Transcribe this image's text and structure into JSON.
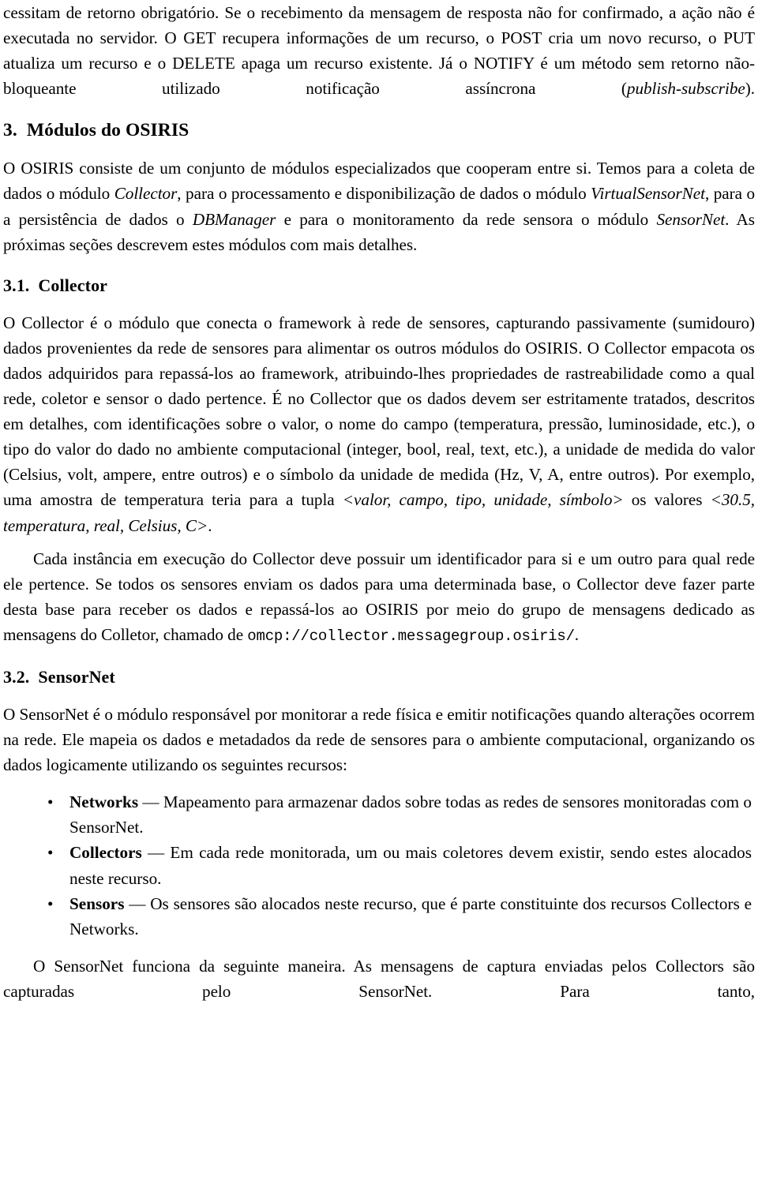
{
  "document": {
    "language": "pt-BR",
    "paragraphs": {
      "p_intro_continuation": {
        "lead": "cessitam de retorno obrigatório. Se o recebimento da mensagem de resposta não for confirmado, a ação não é executada no servidor. O GET recupera informações de um recurso, o POST cria um novo recurso, o PUT atualiza um recurso e o DELETE apaga um recurso existente. Já o NOTIFY é um método sem retorno não-bloqueante utilizado notificação assíncrona (",
        "italic": "publish-subscribe",
        "tail": ")."
      },
      "p_modules_overview": {
        "s1": "O OSIRIS consiste de um conjunto de módulos especializados que cooperam entre si. Temos para a coleta de dados o módulo ",
        "i1": "Collector",
        "s2": ", para o processamento e disponibilização de dados o módulo ",
        "i2": "VirtualSensorNet",
        "s3": ", para o a persistência de dados o ",
        "i3": "DBManager",
        "s4": " e para o monitoramento da rede sensora o módulo ",
        "i4": "SensorNet",
        "s5": ". As próximas seções descrevem estes módulos com mais detalhes."
      },
      "p_collector_1": {
        "s1": "O Collector é o módulo que conecta o framework à rede de sensores, capturando passivamente (sumidouro) dados provenientes da rede de sensores para alimentar os outros módulos do OSIRIS. O Collector empacota os dados adquiridos para repassá-los ao framework, atribuindo-lhes propriedades de rastreabilidade como a qual rede, coletor e sensor o dado pertence. É no Collector que os dados devem ser estritamente tratados, descritos em detalhes, com identificações sobre o valor, o nome do campo (temperatura, pressão, luminosidade, etc.), o tipo do valor do dado no ambiente computacional (integer, bool, real, text, etc.), a unidade de medida do valor (Celsius, volt, ampere, entre outros) e o símbolo da unidade de medida (Hz, V, A, entre outros). Por exemplo, uma amostra de temperatura teria para a tupla ",
        "i1": "<valor, campo, tipo, unidade, símbolo>",
        "s2": " os valores ",
        "i2": "<30.5, temperatura, real, Celsius, C>",
        "s3": "."
      },
      "p_collector_2": {
        "s1": "Cada instância em execução do Collector deve possuir um identificador para si e um outro para qual rede ele pertence. Se todos os sensores enviam os dados para uma determinada base, o Collector deve fazer parte desta base para receber os dados e repassá-los ao OSIRIS por meio do grupo de mensagens dedicado as mensagens do Colletor, chamado de ",
        "mono": "omcp://collector.messagegroup.osiris/",
        "s2": "."
      },
      "p_sensornet_1": "O SensorNet é o módulo responsável por monitorar a rede física e emitir notificações quando alterações ocorrem na rede. Ele mapeia os dados e metadados da rede de sensores para o ambiente computacional, organizando os dados logicamente utilizando os seguintes recursos:",
      "p_sensornet_2": "O SensorNet funciona da seguinte maneira. As mensagens de captura enviadas pelos Collectors são capturadas pelo SensorNet. Para tanto,"
    },
    "headings": {
      "section_3": {
        "number": "3.",
        "title": "Módulos do OSIRIS"
      },
      "section_3_1": {
        "number": "3.1.",
        "title": "Collector"
      },
      "section_3_2": {
        "number": "3.2.",
        "title": "SensorNet"
      }
    },
    "bullet_list": {
      "marker": "•",
      "items": [
        {
          "term": "Networks",
          "dash": " — ",
          "text": "Mapeamento para armazenar dados sobre todas as redes de sensores monitoradas com o SensorNet."
        },
        {
          "term": "Collectors",
          "dash": " — ",
          "text": "Em cada rede monitorada, um ou mais coletores devem existir, sendo estes alocados neste recurso."
        },
        {
          "term": "Sensors",
          "dash": " — ",
          "text": "Os sensores são alocados neste recurso, que é parte constituinte dos recursos Collectors e Networks."
        }
      ]
    },
    "colors": {
      "text": "#000000",
      "background": "#ffffff"
    }
  }
}
